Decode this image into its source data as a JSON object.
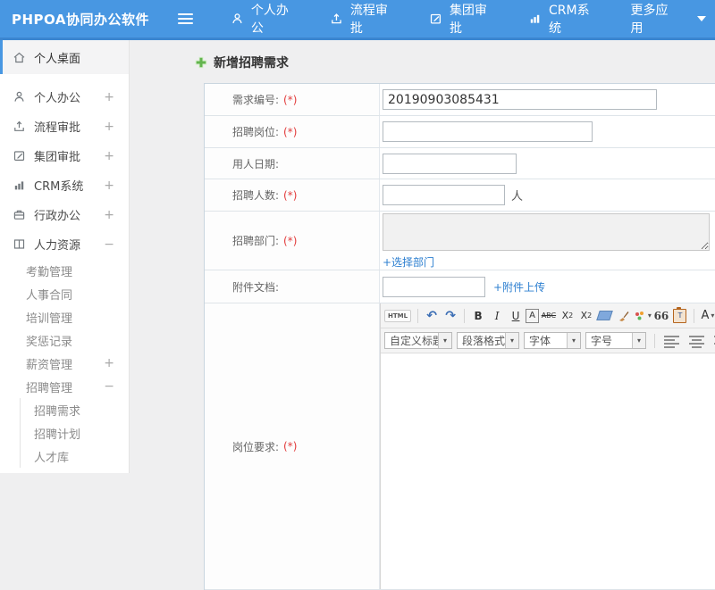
{
  "header": {
    "app_title": "PHPOA协同办公软件",
    "nav": [
      {
        "label": "个人办公"
      },
      {
        "label": "流程审批"
      },
      {
        "label": "集团审批"
      },
      {
        "label": "CRM系统"
      },
      {
        "label": "更多应用"
      }
    ]
  },
  "sidebar": {
    "active_item": {
      "label": "个人桌面"
    },
    "items": [
      {
        "label": "个人办公",
        "expand": "+"
      },
      {
        "label": "流程审批",
        "expand": "+"
      },
      {
        "label": "集团审批",
        "expand": "+"
      },
      {
        "label": "CRM系统",
        "expand": "+"
      },
      {
        "label": "行政办公",
        "expand": "+"
      },
      {
        "label": "人力资源",
        "expand": "−"
      }
    ],
    "hr_children": [
      {
        "label": "考勤管理",
        "expand": ""
      },
      {
        "label": "人事合同",
        "expand": ""
      },
      {
        "label": "培训管理",
        "expand": ""
      },
      {
        "label": "奖惩记录",
        "expand": ""
      },
      {
        "label": "薪资管理",
        "expand": "+"
      },
      {
        "label": "招聘管理",
        "expand": "−"
      }
    ],
    "recruit_children": [
      {
        "label": "招聘需求"
      },
      {
        "label": "招聘计划"
      },
      {
        "label": "人才库"
      }
    ]
  },
  "main": {
    "page_title": "新增招聘需求",
    "form": {
      "rows": [
        {
          "label": "需求编号:",
          "req": "(*)",
          "value": "20190903085431"
        },
        {
          "label": "招聘岗位:",
          "req": "(*)",
          "value": ""
        },
        {
          "label": "用人日期:",
          "req": "",
          "value": ""
        },
        {
          "label": "招聘人数:",
          "req": "(*)",
          "value": "",
          "suffix": "人"
        },
        {
          "label": "招聘部门:",
          "req": "(*)",
          "link": "+选择部门"
        },
        {
          "label": "附件文档:",
          "req": "",
          "link": "+附件上传"
        },
        {
          "label": "岗位要求:",
          "req": "(*)"
        }
      ]
    },
    "editor": {
      "toolbar": {
        "html": "HTML",
        "undo": "↶",
        "redo": "↷",
        "bold": "B",
        "italic": "I",
        "underline": "U",
        "boxed_a": "A",
        "strike": "ABC",
        "sup_base": "X",
        "sup": "2",
        "sub_base": "X",
        "sub": "2",
        "quote": "66",
        "paste": "T",
        "font_color": "A",
        "caret": "▾",
        "clipped": "a"
      },
      "selects": [
        {
          "label": "自定义标题"
        },
        {
          "label": "段落格式"
        },
        {
          "label": "字体"
        },
        {
          "label": "字号"
        }
      ]
    }
  }
}
